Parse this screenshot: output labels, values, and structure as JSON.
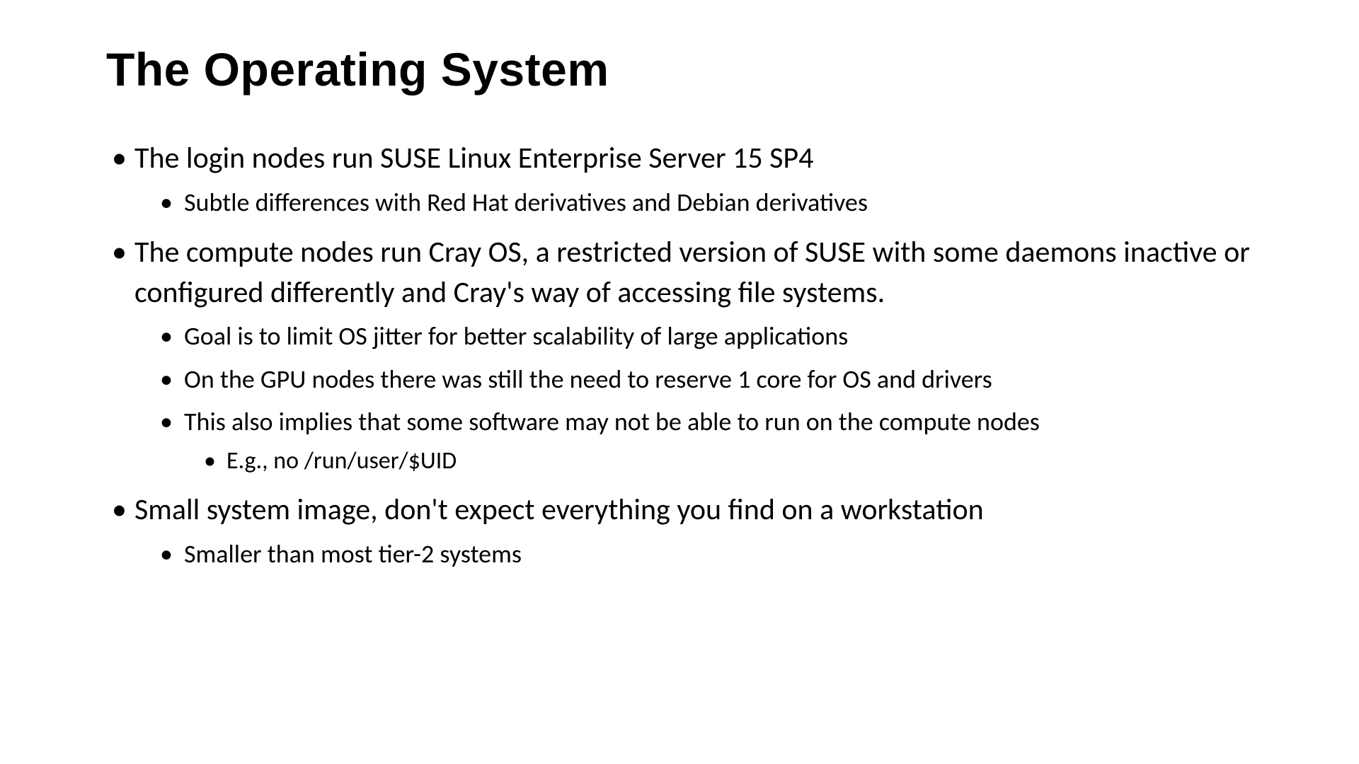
{
  "slide": {
    "title": "The Operating System",
    "bullets": [
      {
        "text": "The login nodes run SUSE Linux Enterprise Server 15 SP4",
        "children": [
          {
            "text": "Subtle differences with Red Hat derivatives and Debian derivatives"
          }
        ]
      },
      {
        "text": "The compute nodes run Cray OS, a restricted version of SUSE with some daemons inactive or configured differently and Cray's way of accessing file systems.",
        "children": [
          {
            "text": "Goal is to limit OS jitter for better scalability of large applications"
          },
          {
            "text": "On the GPU nodes there was still the need to reserve 1 core for OS and drivers"
          },
          {
            "text": "This also implies that some software may not be able to run on the compute nodes",
            "children": [
              {
                "text": "E.g., no /run/user/$UID"
              }
            ]
          }
        ]
      },
      {
        "text": "Small system image, don't expect everything you find on a workstation",
        "children": [
          {
            "text": "Smaller than most tier-2 systems"
          }
        ]
      }
    ]
  }
}
